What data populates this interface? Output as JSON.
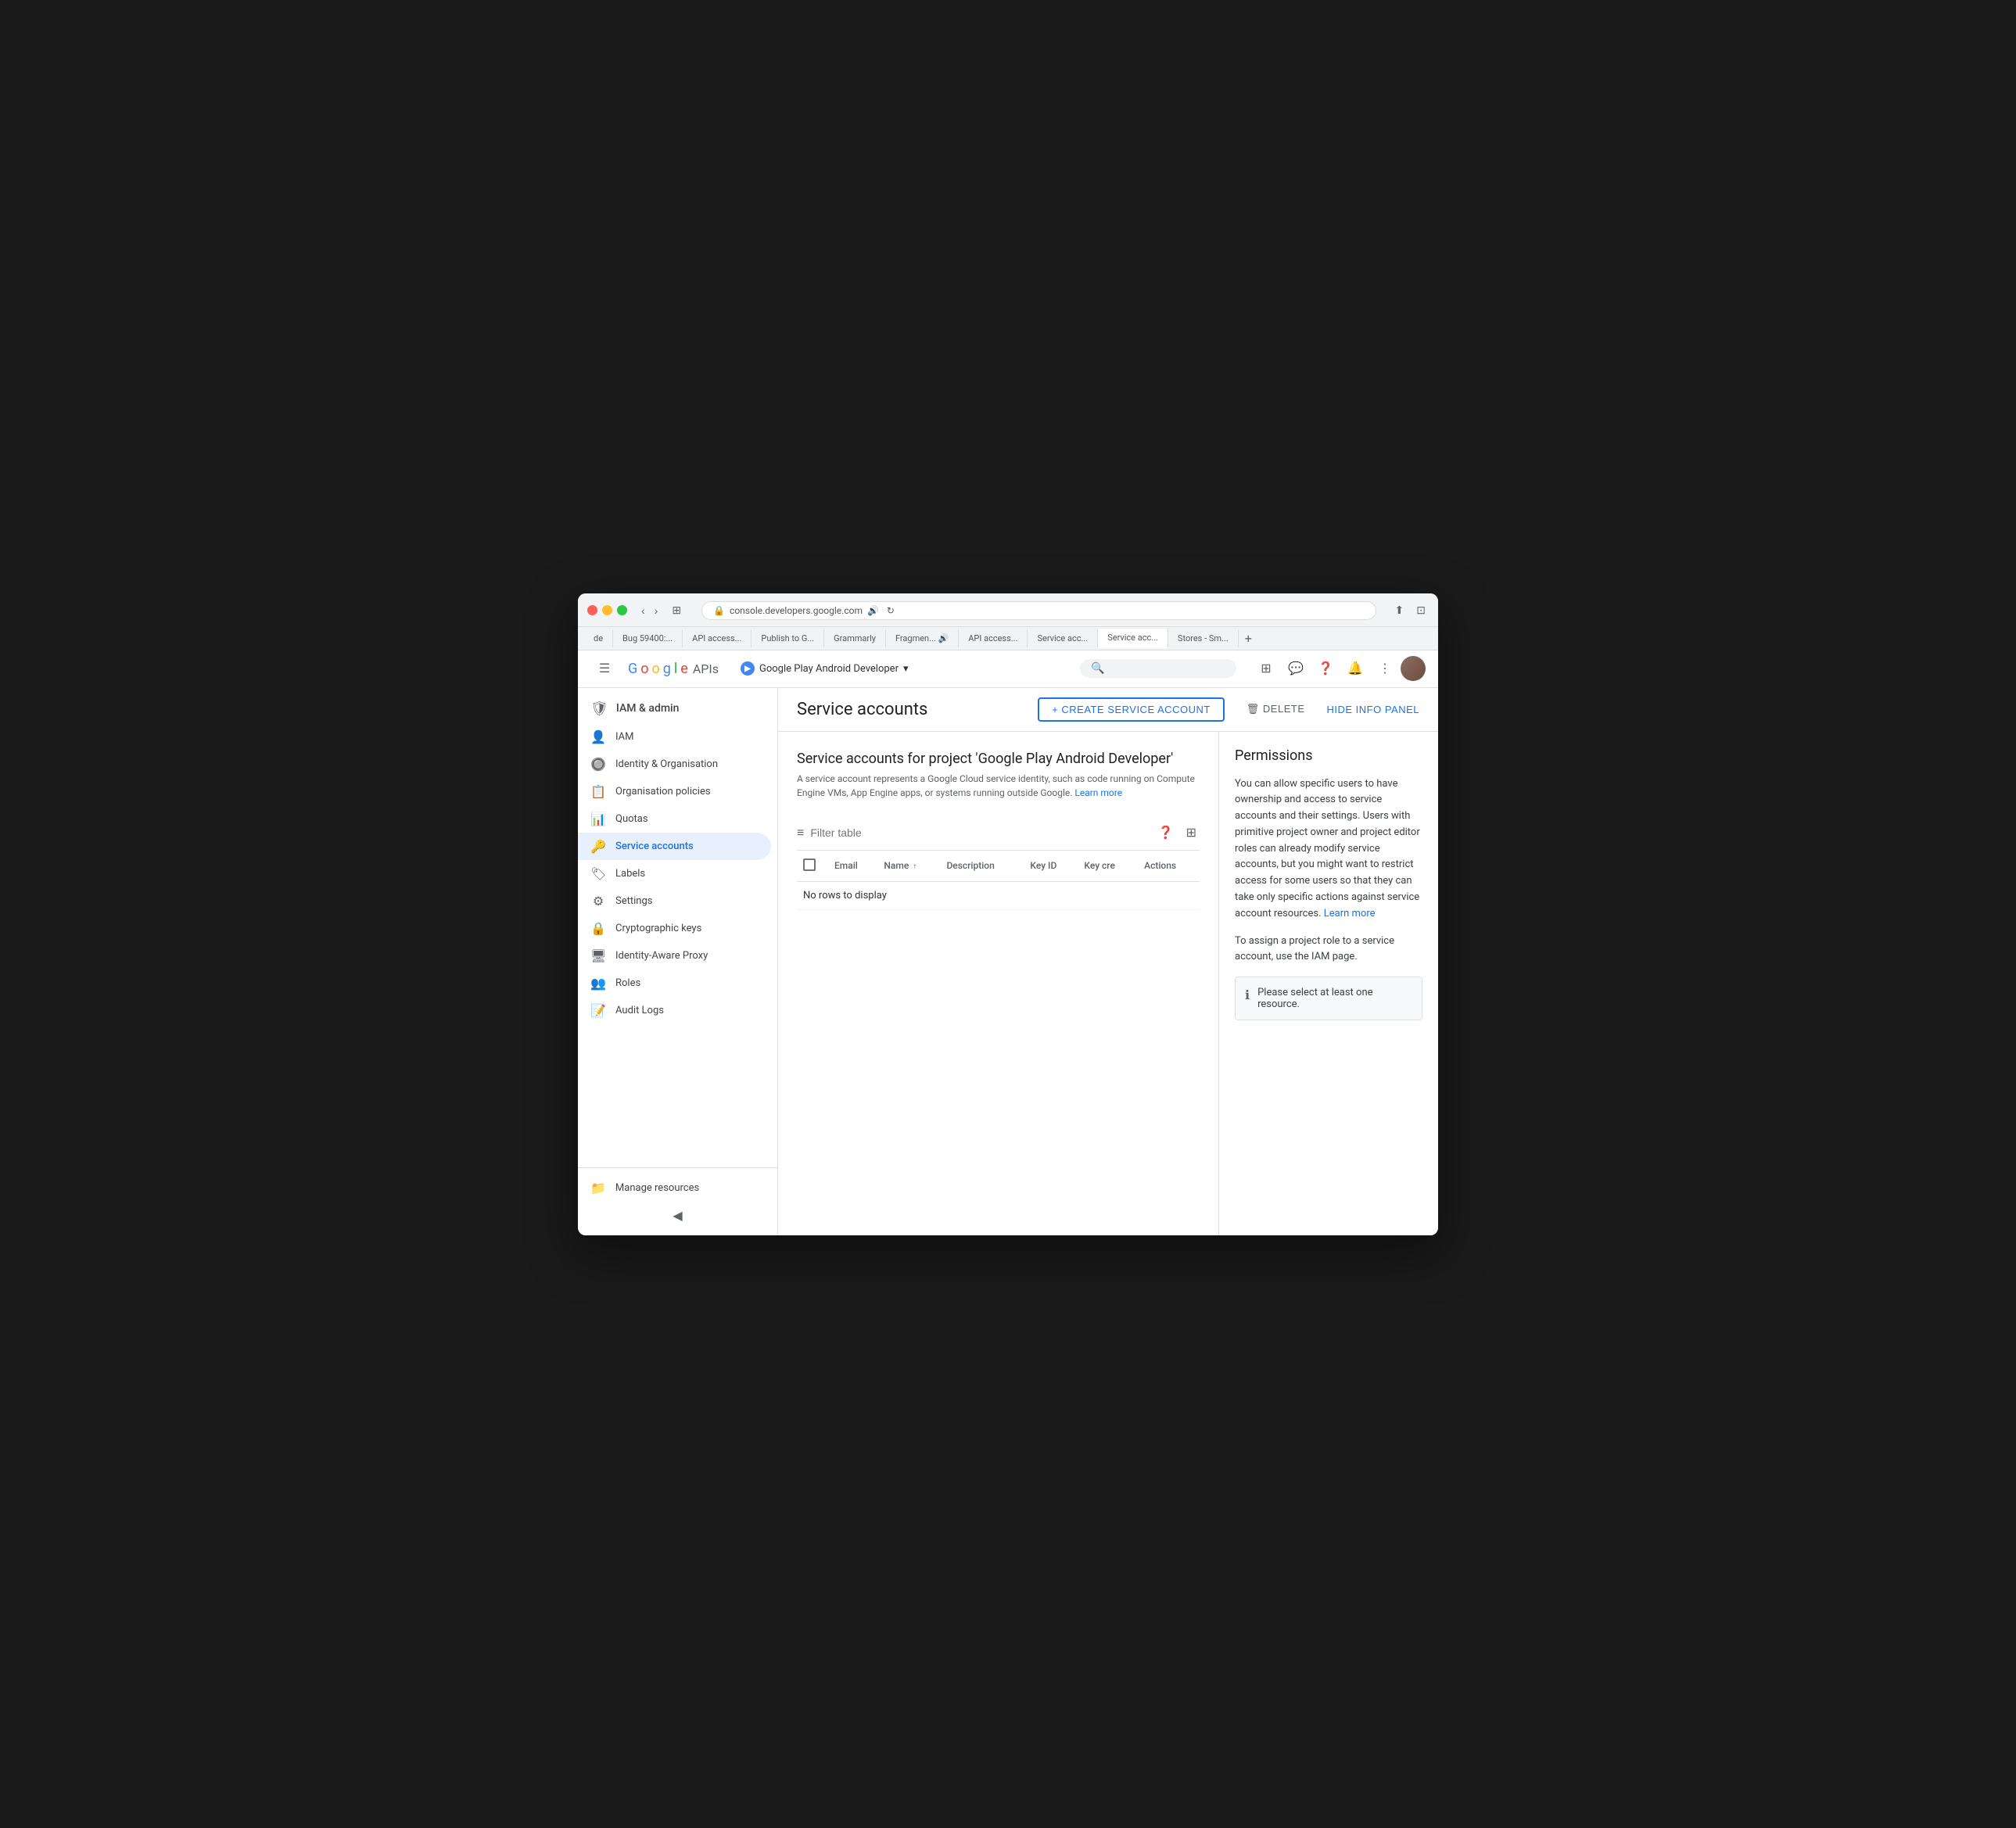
{
  "browser": {
    "url": "console.developers.google.com",
    "tabs": [
      {
        "label": "de"
      },
      {
        "label": "Bug 59400:..."
      },
      {
        "label": "API access..."
      },
      {
        "label": "Publish to G..."
      },
      {
        "label": "Grammarly"
      },
      {
        "label": "Fragmen... 🔊"
      },
      {
        "label": "API access..."
      },
      {
        "label": "Service acc..."
      },
      {
        "label": "Service acc..."
      },
      {
        "label": "Stores - Sm..."
      }
    ]
  },
  "header": {
    "hamburger_label": "☰",
    "google_apis_label": "Google APIs",
    "project_name": "Google Play Android Developer",
    "dropdown_icon": "▼",
    "search_placeholder": ""
  },
  "sidebar": {
    "title": "IAM & admin",
    "items": [
      {
        "label": "IAM",
        "icon": "👤",
        "id": "iam"
      },
      {
        "label": "Identity & Organisation",
        "icon": "🔘",
        "id": "identity"
      },
      {
        "label": "Organisation policies",
        "icon": "📋",
        "id": "org-policies"
      },
      {
        "label": "Quotas",
        "icon": "📊",
        "id": "quotas"
      },
      {
        "label": "Service accounts",
        "icon": "🔑",
        "id": "service-accounts",
        "active": true
      },
      {
        "label": "Labels",
        "icon": "🏷",
        "id": "labels"
      },
      {
        "label": "Settings",
        "icon": "⚙",
        "id": "settings"
      },
      {
        "label": "Cryptographic keys",
        "icon": "🔒",
        "id": "crypto-keys"
      },
      {
        "label": "Identity-Aware Proxy",
        "icon": "🖥",
        "id": "iap"
      },
      {
        "label": "Roles",
        "icon": "👥",
        "id": "roles"
      },
      {
        "label": "Audit Logs",
        "icon": "📝",
        "id": "audit-logs"
      }
    ],
    "bottom": {
      "manage_resources": "Manage resources",
      "collapse_icon": "◀"
    }
  },
  "content": {
    "page_title": "Service accounts",
    "create_button": "+ CREATE SERVICE ACCOUNT",
    "delete_button": "🗑 DELETE",
    "hide_panel_button": "HIDE INFO PANEL",
    "section_title": "Service accounts for project 'Google Play Android Developer'",
    "section_description": "A service account represents a Google Cloud service identity, such as code running on Compute Engine VMs, App Engine apps, or systems running outside Google.",
    "learn_more": "Learn more",
    "filter_placeholder": "Filter table",
    "table": {
      "columns": [
        {
          "label": "",
          "type": "checkbox"
        },
        {
          "label": "Email"
        },
        {
          "label": "Name ↑"
        },
        {
          "label": "Description"
        },
        {
          "label": "Key ID"
        },
        {
          "label": "Key cre"
        },
        {
          "label": "Actions"
        }
      ],
      "no_rows_text": "No rows to display"
    }
  },
  "permissions": {
    "title": "Permissions",
    "paragraph1": "You can allow specific users to have ownership and access to service accounts and their settings. Users with primitive project owner and project editor roles can already modify service accounts, but you might want to restrict access for some users so that they can take only specific actions against service account resources.",
    "learn_more_1": "Learn more",
    "paragraph2": "To assign a project role to a service account, use the IAM page.",
    "info_box_text": "Please select at least one resource.",
    "info_icon": "ℹ"
  }
}
